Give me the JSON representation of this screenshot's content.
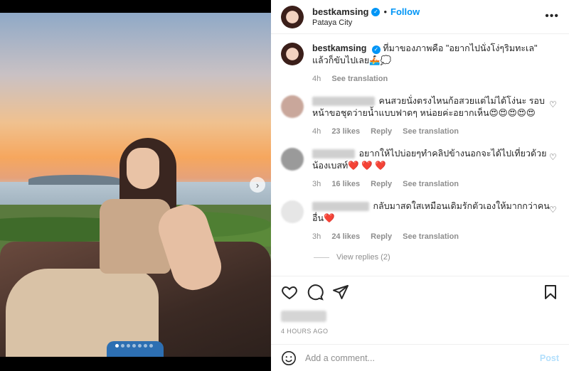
{
  "header": {
    "username": "bestkamsing",
    "verified_icon": "✓",
    "separator": "•",
    "follow_label": "Follow",
    "location": "Pataya City",
    "more_icon": "•••"
  },
  "media": {
    "next_icon": "›",
    "slide_count": 7,
    "active_slide": 1
  },
  "caption": {
    "username": "bestkamsing",
    "text": "ที่มาของภาพคือ \"อยากไปนั่งโง่ๆริมทะเล\" แล้วก็ขับไปเลย🚣🏻💭",
    "time": "4h",
    "see_translation": "See translation"
  },
  "comments": [
    {
      "text": "คนสวยนั่งตรงไหนก้อสวยแต่ไม่ได้โง่นะ รอบหน้าขอชุดว่ายน้ำแบบฟาดๆ หน่อยค่ะอยากเห็น😍😍😍😍😍",
      "time": "4h",
      "likes": "23 likes",
      "reply": "Reply",
      "see_translation": "See translation"
    },
    {
      "text": "อยากให้ไปบ่อยๆทำคลิปข้างนอกจะได้ไปเที่ยวด้วยน้องเบสท์❤️ ❤️ ❤️",
      "time": "3h",
      "likes": "16 likes",
      "reply": "Reply",
      "see_translation": "See translation"
    },
    {
      "text": "กลับมาสดใสเหมือนเดิมรักตัวเองให้มากกว่าคนอื่น❤️",
      "time": "3h",
      "likes": "24 likes",
      "reply": "Reply",
      "see_translation": "See translation"
    }
  ],
  "view_replies": "View replies (2)",
  "heart_icon": "♡",
  "footer": {
    "timestamp": "4 HOURS AGO",
    "comment_placeholder": "Add a comment...",
    "post_label": "Post"
  },
  "colors": {
    "accent": "#0095f6",
    "post_disabled": "#b2dffc",
    "muted": "#8e8e8e"
  }
}
